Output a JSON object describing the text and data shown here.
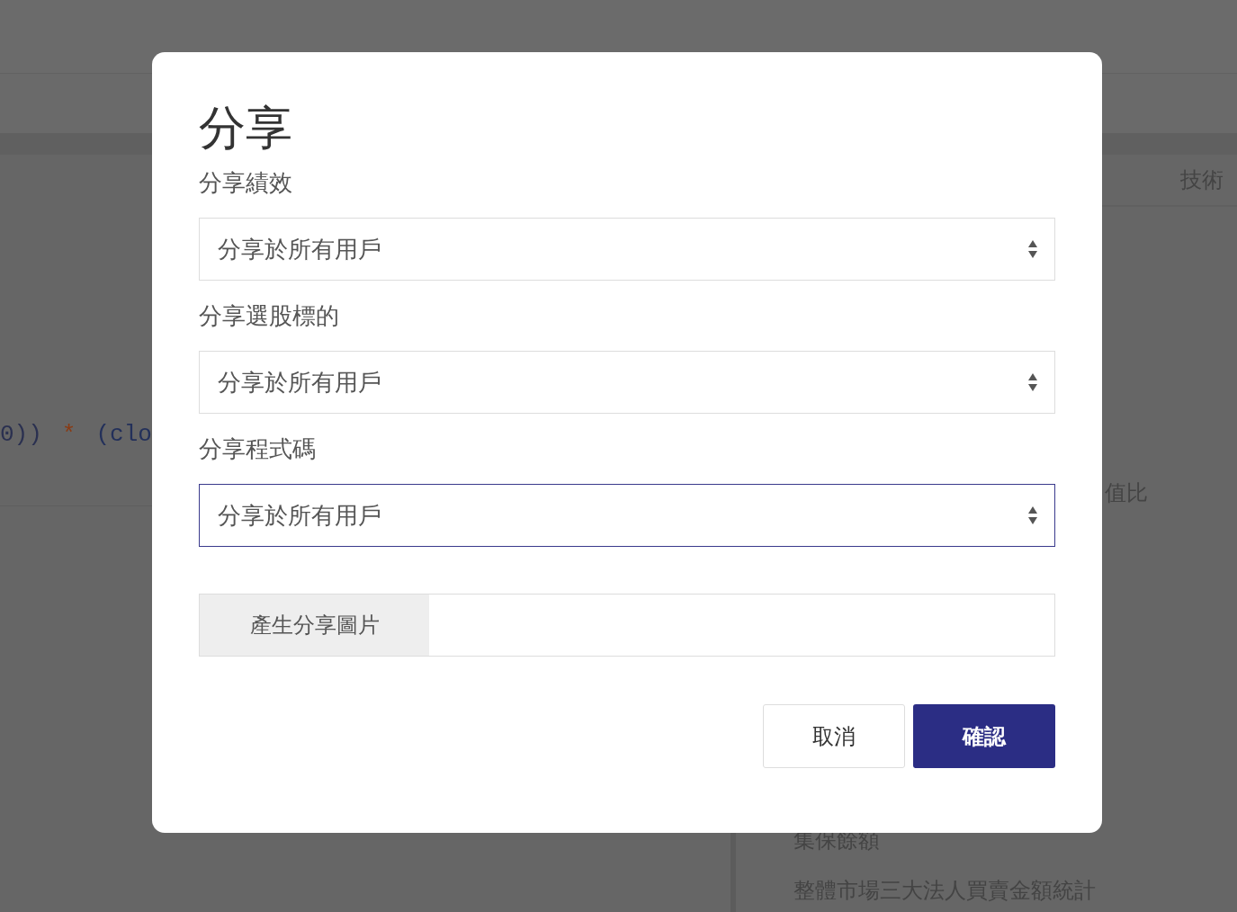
{
  "background": {
    "code_tokens": [
      {
        "text": "0))",
        "color": "#2a3050"
      },
      {
        "text": "*",
        "color": "#8a3a12"
      },
      {
        "text": "(clo",
        "color": "#23305a"
      }
    ],
    "tab": "技術",
    "metric": "值比",
    "list_items": [
      "集保餘額",
      "整體市場三大法人買賣金額統計"
    ]
  },
  "modal": {
    "title": "分享",
    "fields": [
      {
        "label": "分享績效",
        "value": "分享於所有用戶",
        "focused": false
      },
      {
        "label": "分享選股標的",
        "value": "分享於所有用戶",
        "focused": false
      },
      {
        "label": "分享程式碼",
        "value": "分享於所有用戶",
        "focused": true
      }
    ],
    "image_button": "產生分享圖片",
    "buttons": [
      {
        "label": "取消",
        "kind": "secondary"
      },
      {
        "label": "確認",
        "kind": "primary"
      }
    ]
  }
}
